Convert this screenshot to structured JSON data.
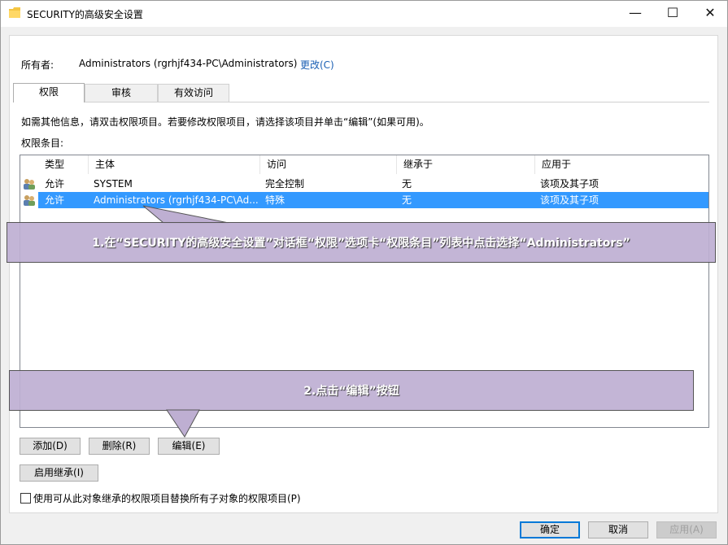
{
  "window": {
    "title": "SECURITY的高级安全设置",
    "minimize_icon": "minimize-icon",
    "maximize_icon": "maximize-icon",
    "close_icon": "close-icon"
  },
  "owner": {
    "label": "所有者:",
    "value": "Administrators (rgrhjf434-PC\\Administrators)",
    "change_link": "更改(C)"
  },
  "tabs": [
    {
      "label": "权限",
      "active": true
    },
    {
      "label": "审核",
      "active": false
    },
    {
      "label": "有效访问",
      "active": false
    }
  ],
  "info_text": "如需其他信息，请双击权限项目。若要修改权限项目，请选择该项目并单击“编辑”(如果可用)。",
  "entries_label": "权限条目:",
  "columns": [
    "类型",
    "主体",
    "访问",
    "继承于",
    "应用于"
  ],
  "rows": [
    {
      "type": "允许",
      "principal": "SYSTEM",
      "access": "完全控制",
      "inherited": "无",
      "applies": "该项及其子项",
      "selected": false
    },
    {
      "type": "允许",
      "principal": "Administrators (rgrhjf434-PC\\Ad...",
      "access": "特殊",
      "inherited": "无",
      "applies": "该项及其子项",
      "selected": true
    }
  ],
  "buttons": {
    "add": "添加(D)",
    "remove": "删除(R)",
    "edit": "编辑(E)",
    "enable_inheritance": "启用继承(I)",
    "ok": "确定",
    "cancel": "取消",
    "apply": "应用(A)"
  },
  "replace_checkbox": {
    "label": "使用可从此对象继承的权限项目替换所有子对象的权限项目(P)",
    "checked": false
  },
  "callouts": {
    "step1": "1.在“SECURITY的高级安全设置”对话框“权限”选项卡“权限条目”列表中点击选择“Administrators”",
    "step2": "2.点击“编辑”按钮"
  },
  "colors": {
    "selection": "#3399ff",
    "callout": "#beafd2",
    "link": "#1a5fb4"
  }
}
